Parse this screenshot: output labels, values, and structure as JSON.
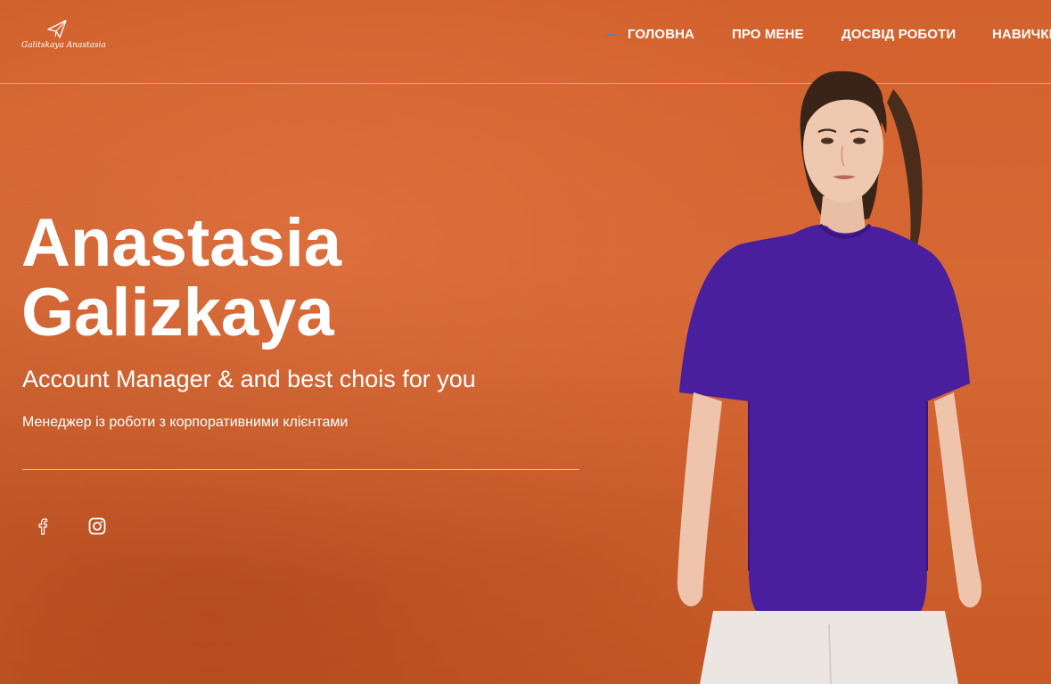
{
  "header": {
    "logo_text": "Galitskaya Anastasia",
    "nav": [
      {
        "label": "ГОЛОВНА",
        "active": true
      },
      {
        "label": "ПРО МЕНЕ",
        "active": false
      },
      {
        "label": "ДОСВІД РОБОТИ",
        "active": false
      },
      {
        "label": "НАВИЧКИ",
        "active": false
      }
    ]
  },
  "hero": {
    "name_first": "Anastasia",
    "name_last": "Galizkaya",
    "role": "Account Manager & and best chois for you",
    "subtitle": "Менеджер із роботи з корпоративними клієнтами"
  },
  "social": [
    {
      "icon": "facebook-icon"
    },
    {
      "icon": "instagram-icon"
    }
  ],
  "colors": {
    "background": "#d0602c",
    "shirt": "#4a1f9e",
    "active_indicator": "#5d7fa6",
    "text": "#ffffff"
  }
}
